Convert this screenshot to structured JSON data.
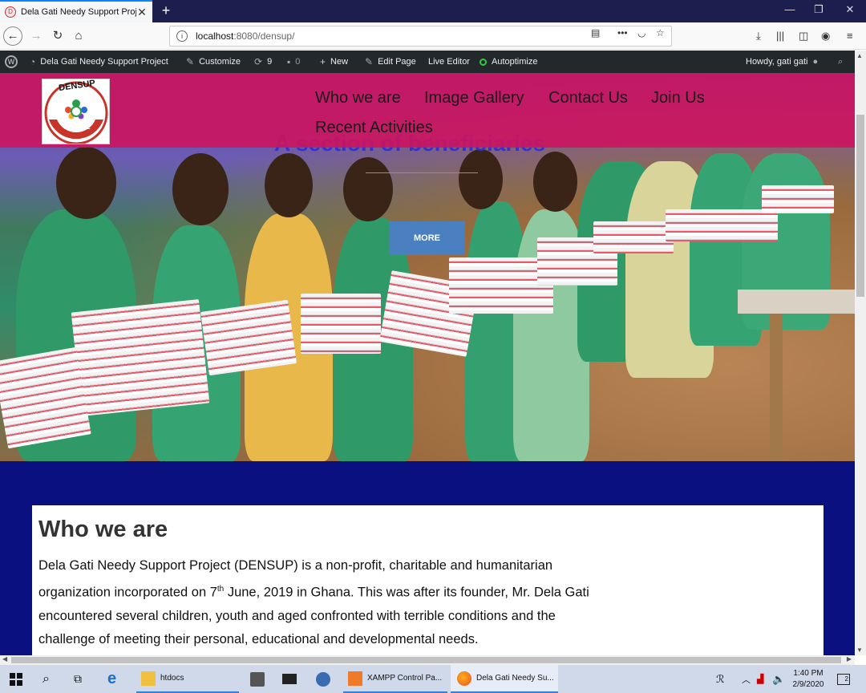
{
  "browser": {
    "tab_title": "Dela Gati Needy Support Proje",
    "url_host": "localhost",
    "url_path": ":8080/densup/"
  },
  "wp_admin": {
    "site_name": "Dela Gati Needy Support Project",
    "customize": "Customize",
    "updates_count": "9",
    "comments_count": "0",
    "new": "New",
    "edit_page": "Edit Page",
    "live_editor": "Live Editor",
    "autoptimize": "Autoptimize",
    "howdy": "Howdy, gati gati"
  },
  "header": {
    "logo_top": "DENSUP",
    "logo_bottom": "WE CARE",
    "nav": [
      "Who we are",
      "Image Gallery",
      "Contact Us",
      "Join Us",
      "Recent Activities"
    ]
  },
  "hero": {
    "title": "A section of beneficiaries",
    "button": "MORE"
  },
  "content": {
    "heading": "Who we are",
    "p_part1": "Dela Gati Needy Support Project (DENSUP) is a non-profit, charitable and humanitarian organization incorporated on 7",
    "p_sup": "th",
    "p_part2": " June, 2019 in Ghana. This was after its founder, Mr. Dela Gati encountered several children, youth and aged confronted with terrible conditions and the challenge of meeting their personal, educational and developmental needs."
  },
  "taskbar": {
    "htdocs": "htdocs",
    "xampp": "XAMPP Control Pa...",
    "firefox": "Dela Gati Needy Su...",
    "time": "1:40 PM",
    "date": "2/9/2020",
    "notif_count": "2"
  },
  "colors": {
    "header_bg": "#cd145f",
    "page_bg": "#0a1080",
    "more_button": "#4a7fc0"
  }
}
